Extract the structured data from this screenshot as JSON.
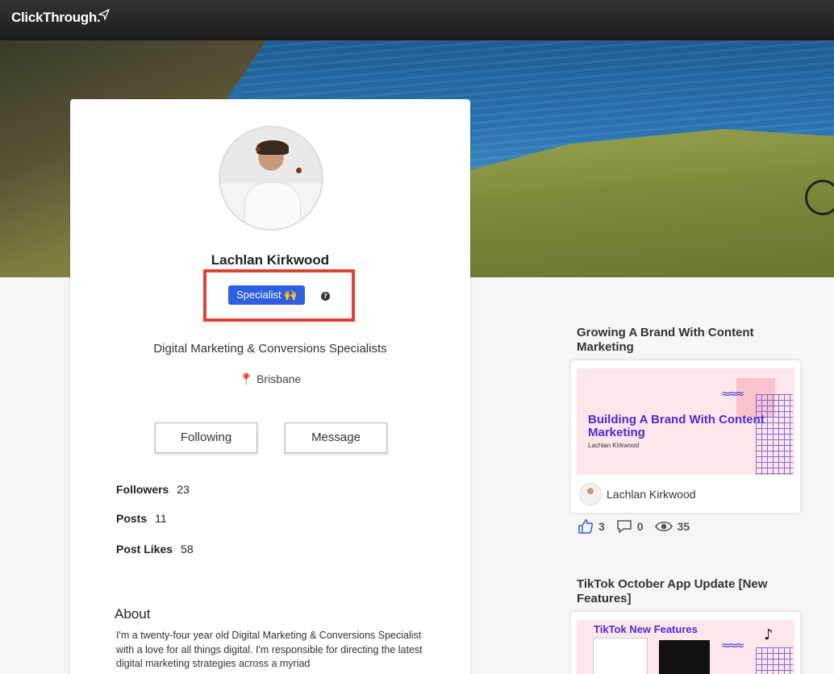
{
  "app": {
    "logo_text": "ClickThrough."
  },
  "profile": {
    "name": "Lachlan Kirkwood",
    "badge": "Specialist 🙌",
    "help_icon": "?",
    "headline": "Digital Marketing & Conversions Specialists",
    "location": "Brisbane",
    "buttons": {
      "following": "Following",
      "message": "Message"
    },
    "stats": [
      {
        "label": "Followers",
        "value": "23"
      },
      {
        "label": "Posts",
        "value": "11"
      },
      {
        "label": "Post Likes",
        "value": "58"
      }
    ],
    "about_title": "About",
    "about_text": "I'm a twenty-four year old Digital Marketing & Conversions Specialist with a love for all things digital. I'm responsible for directing the latest digital marketing strategies across a myriad"
  },
  "posts": [
    {
      "title": "Growing A Brand With Content Marketing",
      "thumb_title": "Building A Brand With Content Marketing",
      "thumb_sub": "Lachlan Kirkwood",
      "author": "Lachlan Kirkwood",
      "likes": "3",
      "comments": "0",
      "views": "35"
    },
    {
      "title": "TikTok October App Update [New Features]",
      "thumb_title": "TikTok New Features"
    }
  ],
  "colors": {
    "badge_blue": "#2d5fe3",
    "highlight_red": "#e2412f",
    "brand_purple": "#4b2bd8"
  }
}
